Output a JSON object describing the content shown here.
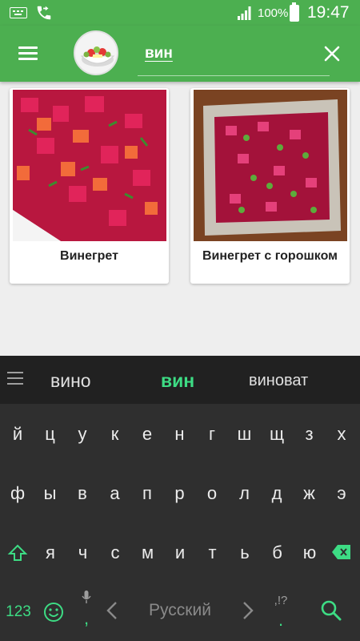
{
  "status_bar": {
    "battery_percent": "100%",
    "time": "19:47"
  },
  "app_bar": {
    "search_value": "вин",
    "colors": {
      "primary": "#4caf50",
      "text": "#ffffff"
    }
  },
  "results": [
    {
      "title": "Винегрет"
    },
    {
      "title": "Винегрет с горошком"
    }
  ],
  "keyboard": {
    "suggestions": [
      "вино",
      "вин",
      "виноват"
    ],
    "row1": [
      "й",
      "ц",
      "у",
      "к",
      "е",
      "н",
      "г",
      "ш",
      "щ",
      "з",
      "х"
    ],
    "row2": [
      "ф",
      "ы",
      "в",
      "а",
      "п",
      "р",
      "о",
      "л",
      "д",
      "ж",
      "э"
    ],
    "row3": [
      "я",
      "ч",
      "с",
      "м",
      "и",
      "т",
      "ь",
      "б",
      "ю"
    ],
    "numbers_key": "123",
    "comma_key": ",",
    "space_label": "Русский",
    "punct_key_top": ",!?",
    "period_key": ".",
    "accent_color": "#3ddc84"
  }
}
